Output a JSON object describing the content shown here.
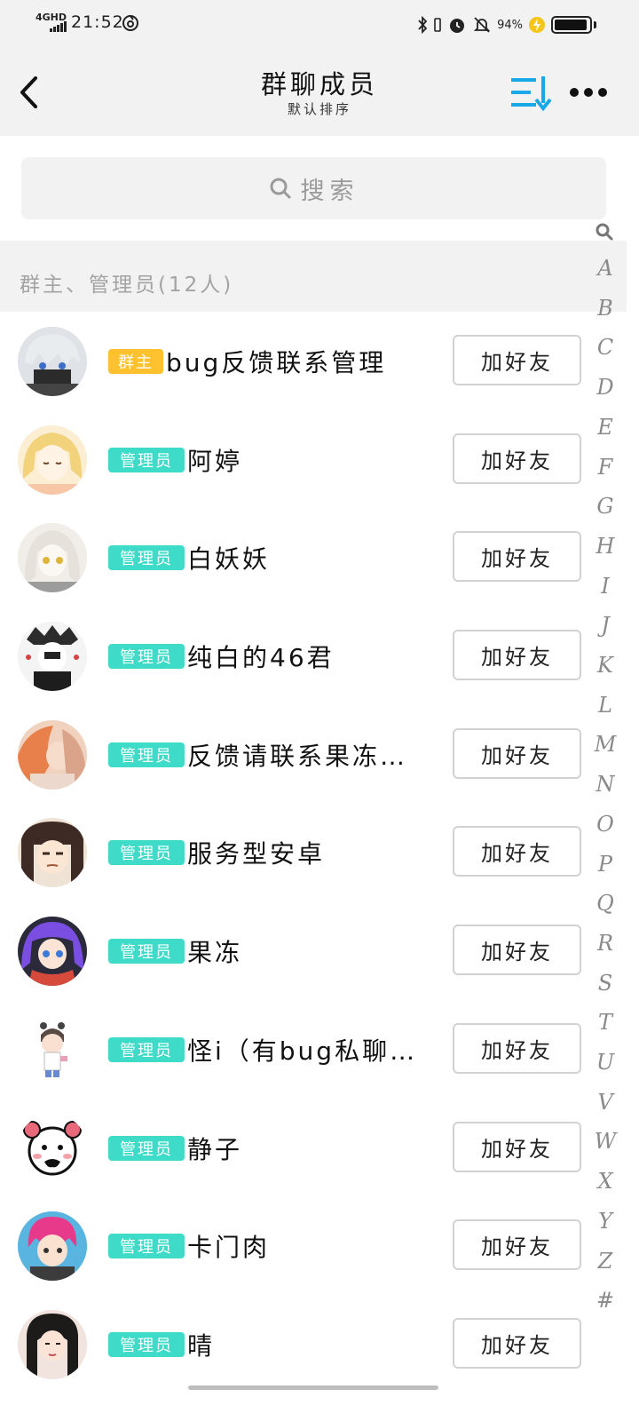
{
  "status_bar": {
    "network": "4GHD",
    "time": "21:52",
    "battery_percent": "94%",
    "battery_level": 0.94
  },
  "header": {
    "title": "群聊成员",
    "subtitle": "默认排序",
    "accent_color": "#1aa9e8"
  },
  "search": {
    "placeholder": "搜索"
  },
  "section": {
    "title": "群主、管理员(12人)"
  },
  "members": [
    {
      "role": "群主",
      "role_type": "owner",
      "name": "bug反馈联系管理",
      "button": "加好友",
      "avatar_color": "#7e8a9a"
    },
    {
      "role": "管理员",
      "role_type": "admin",
      "name": "阿婷",
      "button": "加好友",
      "avatar_color": "#f4d58a"
    },
    {
      "role": "管理员",
      "role_type": "admin",
      "name": "白妖妖",
      "button": "加好友",
      "avatar_color": "#e9e3dc"
    },
    {
      "role": "管理员",
      "role_type": "admin",
      "name": "纯白的46君",
      "button": "加好友",
      "avatar_color": "#3b3b3b"
    },
    {
      "role": "管理员",
      "role_type": "admin",
      "name": "反馈请联系果冻…",
      "button": "加好友",
      "avatar_color": "#e2a27d"
    },
    {
      "role": "管理员",
      "role_type": "admin",
      "name": "服务型安卓",
      "button": "加好友",
      "avatar_color": "#5a4038"
    },
    {
      "role": "管理员",
      "role_type": "admin",
      "name": "果冻",
      "button": "加好友",
      "avatar_color": "#6b4fcf"
    },
    {
      "role": "管理员",
      "role_type": "admin",
      "name": "怪i（有bug私聊…",
      "button": "加好友",
      "avatar_color": "#ffffff"
    },
    {
      "role": "管理员",
      "role_type": "admin",
      "name": "静子",
      "button": "加好友",
      "avatar_color": "#ffffff"
    },
    {
      "role": "管理员",
      "role_type": "admin",
      "name": "卡门肉",
      "button": "加好友",
      "avatar_color": "#3aa6d8"
    },
    {
      "role": "管理员",
      "role_type": "admin",
      "name": "晴",
      "button": "加好友",
      "avatar_color": "#e7d6cf"
    }
  ],
  "index_letters": [
    "A",
    "B",
    "C",
    "D",
    "E",
    "F",
    "G",
    "H",
    "I",
    "J",
    "K",
    "L",
    "M",
    "N",
    "O",
    "P",
    "Q",
    "R",
    "S",
    "T",
    "U",
    "V",
    "W",
    "X",
    "Y",
    "Z",
    "#"
  ],
  "colors": {
    "owner_badge": "#ffc12e",
    "admin_badge": "#3ddbc8"
  }
}
